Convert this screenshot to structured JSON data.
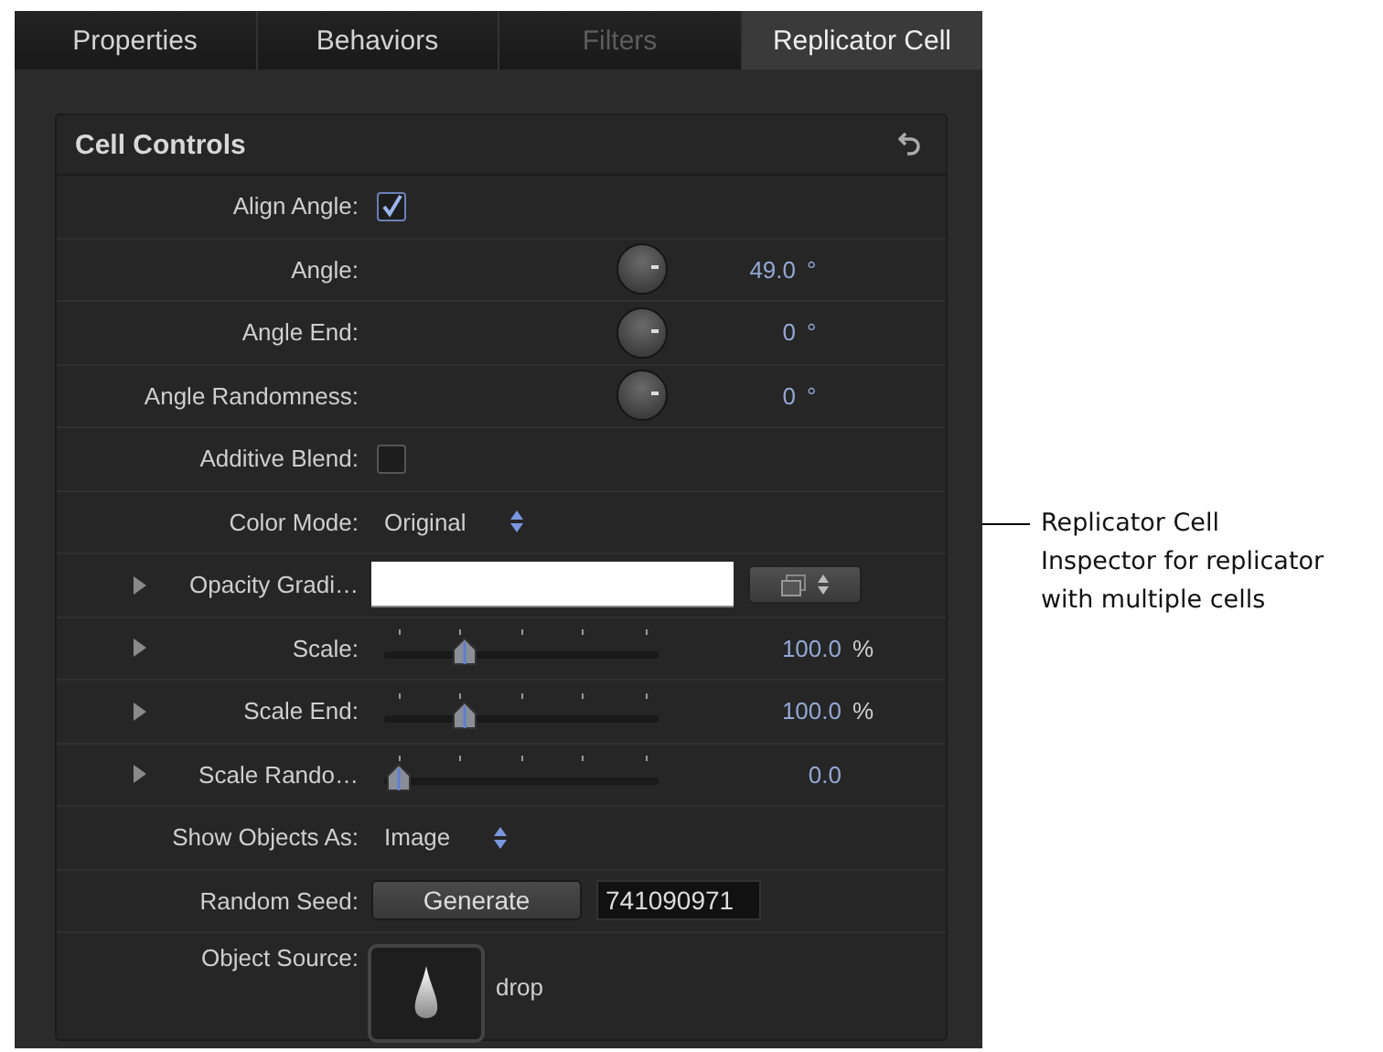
{
  "tabs": [
    {
      "label": "Properties",
      "selected": false,
      "disabled": false
    },
    {
      "label": "Behaviors",
      "selected": false,
      "disabled": false
    },
    {
      "label": "Filters",
      "selected": false,
      "disabled": true
    },
    {
      "label": "Replicator Cell",
      "selected": true,
      "disabled": false
    }
  ],
  "group": {
    "title": "Cell Controls",
    "rows": [
      {
        "kind": "checkbox",
        "label": "Align Angle:",
        "checked": true
      },
      {
        "kind": "dial",
        "label": "Angle:",
        "value": "49.0",
        "unit": "°"
      },
      {
        "kind": "dial",
        "label": "Angle End:",
        "value": "0",
        "unit": "°"
      },
      {
        "kind": "dial",
        "label": "Angle Randomness:",
        "value": "0",
        "unit": "°"
      },
      {
        "kind": "checkbox",
        "label": "Additive Blend:",
        "checked": false
      },
      {
        "kind": "popup",
        "label": "Color Mode:",
        "value": "Original"
      },
      {
        "kind": "gradient",
        "label": "Opacity Gradi…",
        "expanded": false
      },
      {
        "kind": "slider",
        "label": "Scale:",
        "expanded": false,
        "level": 0.27,
        "value": "100.0",
        "unit": "%"
      },
      {
        "kind": "slider",
        "label": "Scale End:",
        "expanded": false,
        "level": 0.27,
        "value": "100.0",
        "unit": "%"
      },
      {
        "kind": "slider",
        "label": "Scale Rando…",
        "expanded": false,
        "level": 0,
        "value": "0.0"
      },
      {
        "kind": "popup",
        "label": "Show Objects As:",
        "value": "Image"
      },
      {
        "kind": "seed",
        "label": "Random Seed:",
        "button": "Generate",
        "value": "741090971"
      },
      {
        "kind": "source",
        "label": "Object Source:",
        "value": "drop"
      }
    ]
  },
  "callout": {
    "text": "Replicator Cell\nInspector for replicator\nwith multiple cells"
  }
}
